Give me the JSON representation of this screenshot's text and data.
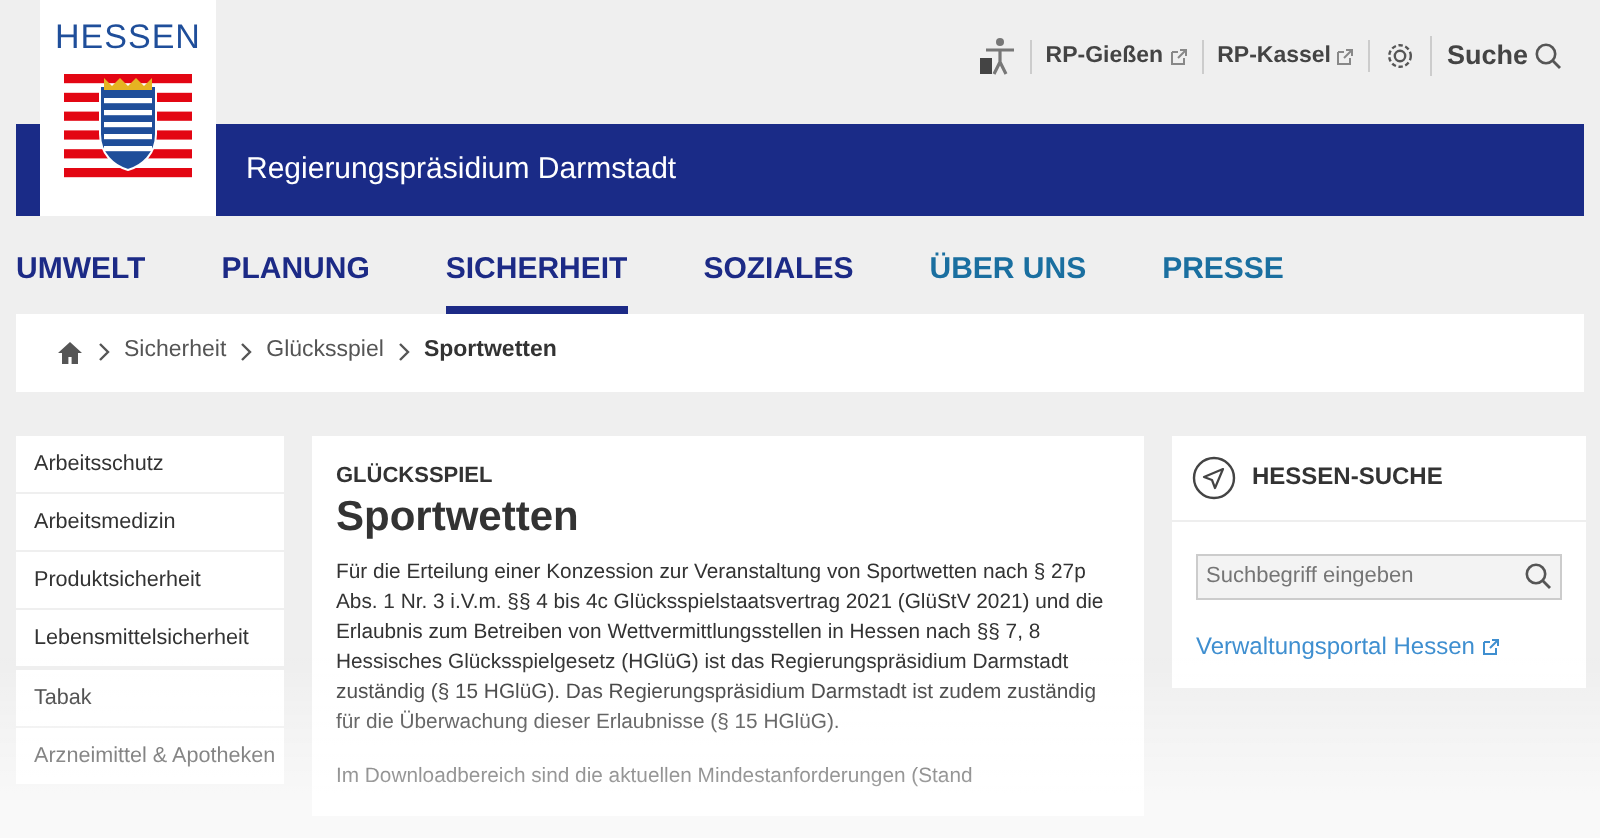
{
  "header": {
    "logo_text": "HESSEN",
    "site_title": "Regierungspräsidium Darmstadt",
    "utility_links": [
      {
        "kind": "accessibility"
      },
      {
        "kind": "external",
        "label": "RP-Gießen"
      },
      {
        "kind": "external",
        "label": "RP-Kassel"
      },
      {
        "kind": "settings"
      },
      {
        "kind": "search",
        "label": "Suche"
      }
    ]
  },
  "main_nav": [
    {
      "label": "UMWELT",
      "kind": "primary",
      "selected": false
    },
    {
      "label": "PLANUNG",
      "kind": "primary",
      "selected": false
    },
    {
      "label": "SICHERHEIT",
      "kind": "primary",
      "selected": true
    },
    {
      "label": "SOZIALES",
      "kind": "primary",
      "selected": false
    },
    {
      "label": "ÜBER UNS",
      "kind": "secondary",
      "selected": false
    },
    {
      "label": "PRESSE",
      "kind": "secondary",
      "selected": false
    }
  ],
  "breadcrumb": [
    "Sicherheit",
    "Glücksspiel",
    "Sportwetten"
  ],
  "sidebar": {
    "items": [
      "Arbeitsschutz",
      "Arbeitsmedizin",
      "Produktsicherheit",
      "Lebensmittelsicherheit",
      "Tabak",
      "Arzneimittel & Apotheken"
    ]
  },
  "article": {
    "kicker": "GLÜCKSSPIEL",
    "title": "Sportwetten",
    "paragraphs": [
      "Für die Erteilung einer Konzession zur Veranstaltung von Sportwetten nach § 27p Abs. 1 Nr. 3 i.V.m. §§ 4 bis 4c Glücksspielstaatsvertrag 2021 (GlüStV 2021) und die Erlaubnis zum Betreiben von Wettvermittlungsstellen in Hessen nach §§ 7, 8 Hessisches Glücksspielgesetz (HGlüG) ist das Regierungspräsidium Darmstadt zuständig (§ 15 HGlüG). Das Regierungspräsidium Darmstadt ist zudem zuständig für die Überwachung dieser Erlaubnisse (§ 15 HGlüG).",
      "Im Downloadbereich sind die aktuellen Mindestanforderungen (Stand"
    ]
  },
  "search_card": {
    "title": "HESSEN-SUCHE",
    "placeholder": "Suchbegriff eingeben",
    "link": "Verwaltungsportal Hessen"
  }
}
